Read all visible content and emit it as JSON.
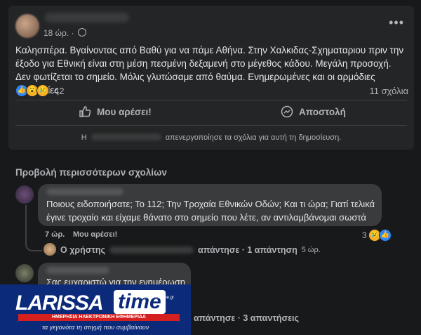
{
  "post": {
    "time": "18 ώρ. ·",
    "text": "Καλησπέρα. Βγαίνοντας από Βαθύ για να πάμε Αθήνα. Στην Χαλκιδας-Σχηματαριου πριν την έξοδο για Εθνική είναι στη μέση πεσμένη δεξαμενή στο μέγεθος κάδου. Μεγάλη προσοχή. Δεν φωτίζεται το σημείο. Μόλις γλυτώσαμε από θαύμα. Ενημερωμένες και οι αρμόδιες υπηρεσίες",
    "reaction_count": "42",
    "comments_count": "11 σχόλια",
    "like_label": "Μου αρέσει!",
    "share_label": "Αποστολή",
    "comments_notice": "απενεργοποίησε τα σχόλια για αυτή τη δημοσίευση."
  },
  "comments": {
    "more_label": "Προβολή περισσότερων σχολίων",
    "first": {
      "text_line1": "Ποιους ειδοποιήσατε; Το 112; Την Τροχαία Εθνικών Οδών; Και τι ώρα; Γιατί τελικά",
      "text_line2": "έγινε τροχαίο και είχαμε θάνατο στο σημείο που λέτε, αν αντιλαμβάνομαι σωστά",
      "time": "7 ώρ.",
      "like_label": "Μου αρέσει!",
      "reaction_count": "3",
      "reply_user": "Ο χρήστης",
      "reply_text": "απάντησε · 1 απάντηση",
      "reply_time": "5 ώρ."
    },
    "second": {
      "text": "Σας ευχαριστώ για την ενημέρωση",
      "reply_text": "απάντησε · 3 απαντήσεις"
    }
  },
  "watermark": {
    "brand_left": "LARISSA",
    "brand_right": "time",
    "site": "www.larissatime.gr",
    "subtitle": "ΗΜΕΡΗΣΙΑ ΗΛΕΚΤΡΟΝΙΚΗ ΕΦΗΜΕΡΙΔΑ",
    "tagline": "τα γεγονότα τη στιγμή που συμβαίνουν"
  },
  "colors": {
    "background": "#18191a",
    "card": "#242526",
    "bubble": "#3a3b3c",
    "accent": "#2d88ff"
  }
}
